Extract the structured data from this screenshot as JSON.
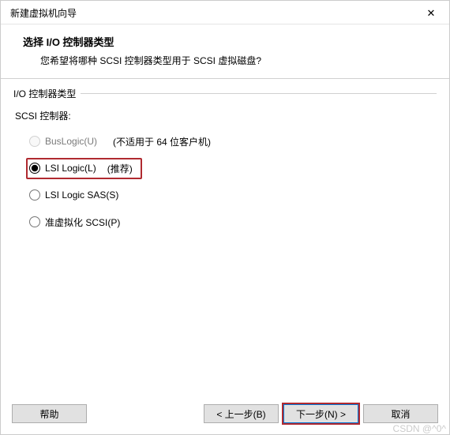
{
  "window": {
    "title": "新建虚拟机向导"
  },
  "header": {
    "title": "选择 I/O 控制器类型",
    "desc": "您希望将哪种 SCSI 控制器类型用于 SCSI 虚拟磁盘?"
  },
  "group": {
    "label": "I/O 控制器类型",
    "subtitle": "SCSI 控制器:",
    "options": [
      {
        "label": "BusLogic(U)",
        "hint": "(不适用于 64 位客户机)",
        "disabled": true,
        "checked": false,
        "highlighted": false
      },
      {
        "label": "LSI Logic(L)",
        "hint": "(推荐)",
        "disabled": false,
        "checked": true,
        "highlighted": true
      },
      {
        "label": "LSI Logic SAS(S)",
        "hint": "",
        "disabled": false,
        "checked": false,
        "highlighted": false
      },
      {
        "label": "准虚拟化 SCSI(P)",
        "hint": "",
        "disabled": false,
        "checked": false,
        "highlighted": false
      }
    ]
  },
  "footer": {
    "help": "帮助",
    "back": "< 上一步(B)",
    "next": "下一步(N) >",
    "cancel": "取消"
  },
  "watermark": "CSDN @^0^"
}
